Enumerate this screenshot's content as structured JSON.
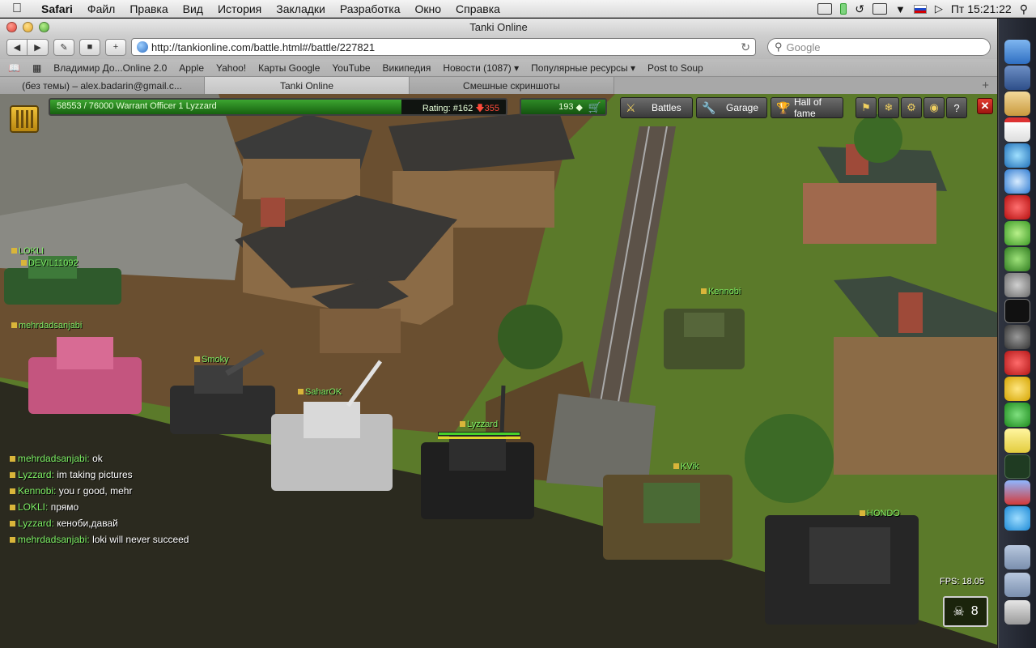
{
  "menubar": {
    "app": "Safari",
    "items": [
      "Файл",
      "Правка",
      "Вид",
      "История",
      "Закладки",
      "Разработка",
      "Окно",
      "Справка"
    ],
    "clock": "Пт 15:21:22"
  },
  "window": {
    "title": "Tanki Online",
    "url": "http://tankionline.com/battle.html#/battle/227821",
    "search_placeholder": "Google"
  },
  "bookmarks": [
    "Владимир До...Online 2.0",
    "Apple",
    "Yahoo!",
    "Карты Google",
    "YouTube",
    "Википедия",
    "Новости (1087) ▾",
    "Популярные ресурсы ▾",
    "Post to Soup"
  ],
  "tabs": [
    "(без темы) – alex.badarin@gmail.c...",
    "Tanki Online",
    "Смешные скриншоты"
  ],
  "hud": {
    "xp_text": "58553 / 76000   Warrant Officer 1 Lyzzard",
    "xp_progress": 0.77,
    "rating_label": "Rating: #162",
    "rating_delta": "355",
    "crystals": "193",
    "battles": "Battles",
    "garage": "Garage",
    "hall_of_fame": "Hall of fame"
  },
  "players": {
    "lokli": "LOKLI",
    "devil": "DEVIL11092",
    "mehrdad": "mehrdadsanjabi",
    "smoky": "Smoky",
    "saharok": "SaharOK",
    "lyzzard": "Lyzzard",
    "kennobi": "Kennobi",
    "kvik": "KVik",
    "hondo": "HONDO"
  },
  "chat": [
    {
      "name": "mehrdadsanjabi:",
      "text": "ok"
    },
    {
      "name": "Lyzzard:",
      "text": "im taking pictures"
    },
    {
      "name": "Kennobi:",
      "text": "you r good, mehr"
    },
    {
      "name": "LOKLI:",
      "text": "прямо"
    },
    {
      "name": "Lyzzard:",
      "text": "кеноби,давай"
    },
    {
      "name": "mehrdadsanjabi:",
      "text": "loki will never succeed"
    }
  ],
  "fps": "FPS:   18.05",
  "kills": "8",
  "colors": {
    "grass": "#5f7b2c",
    "dirt": "#6a4f30",
    "hud_green": "#2e8a26",
    "nick_green": "#7ef065"
  }
}
